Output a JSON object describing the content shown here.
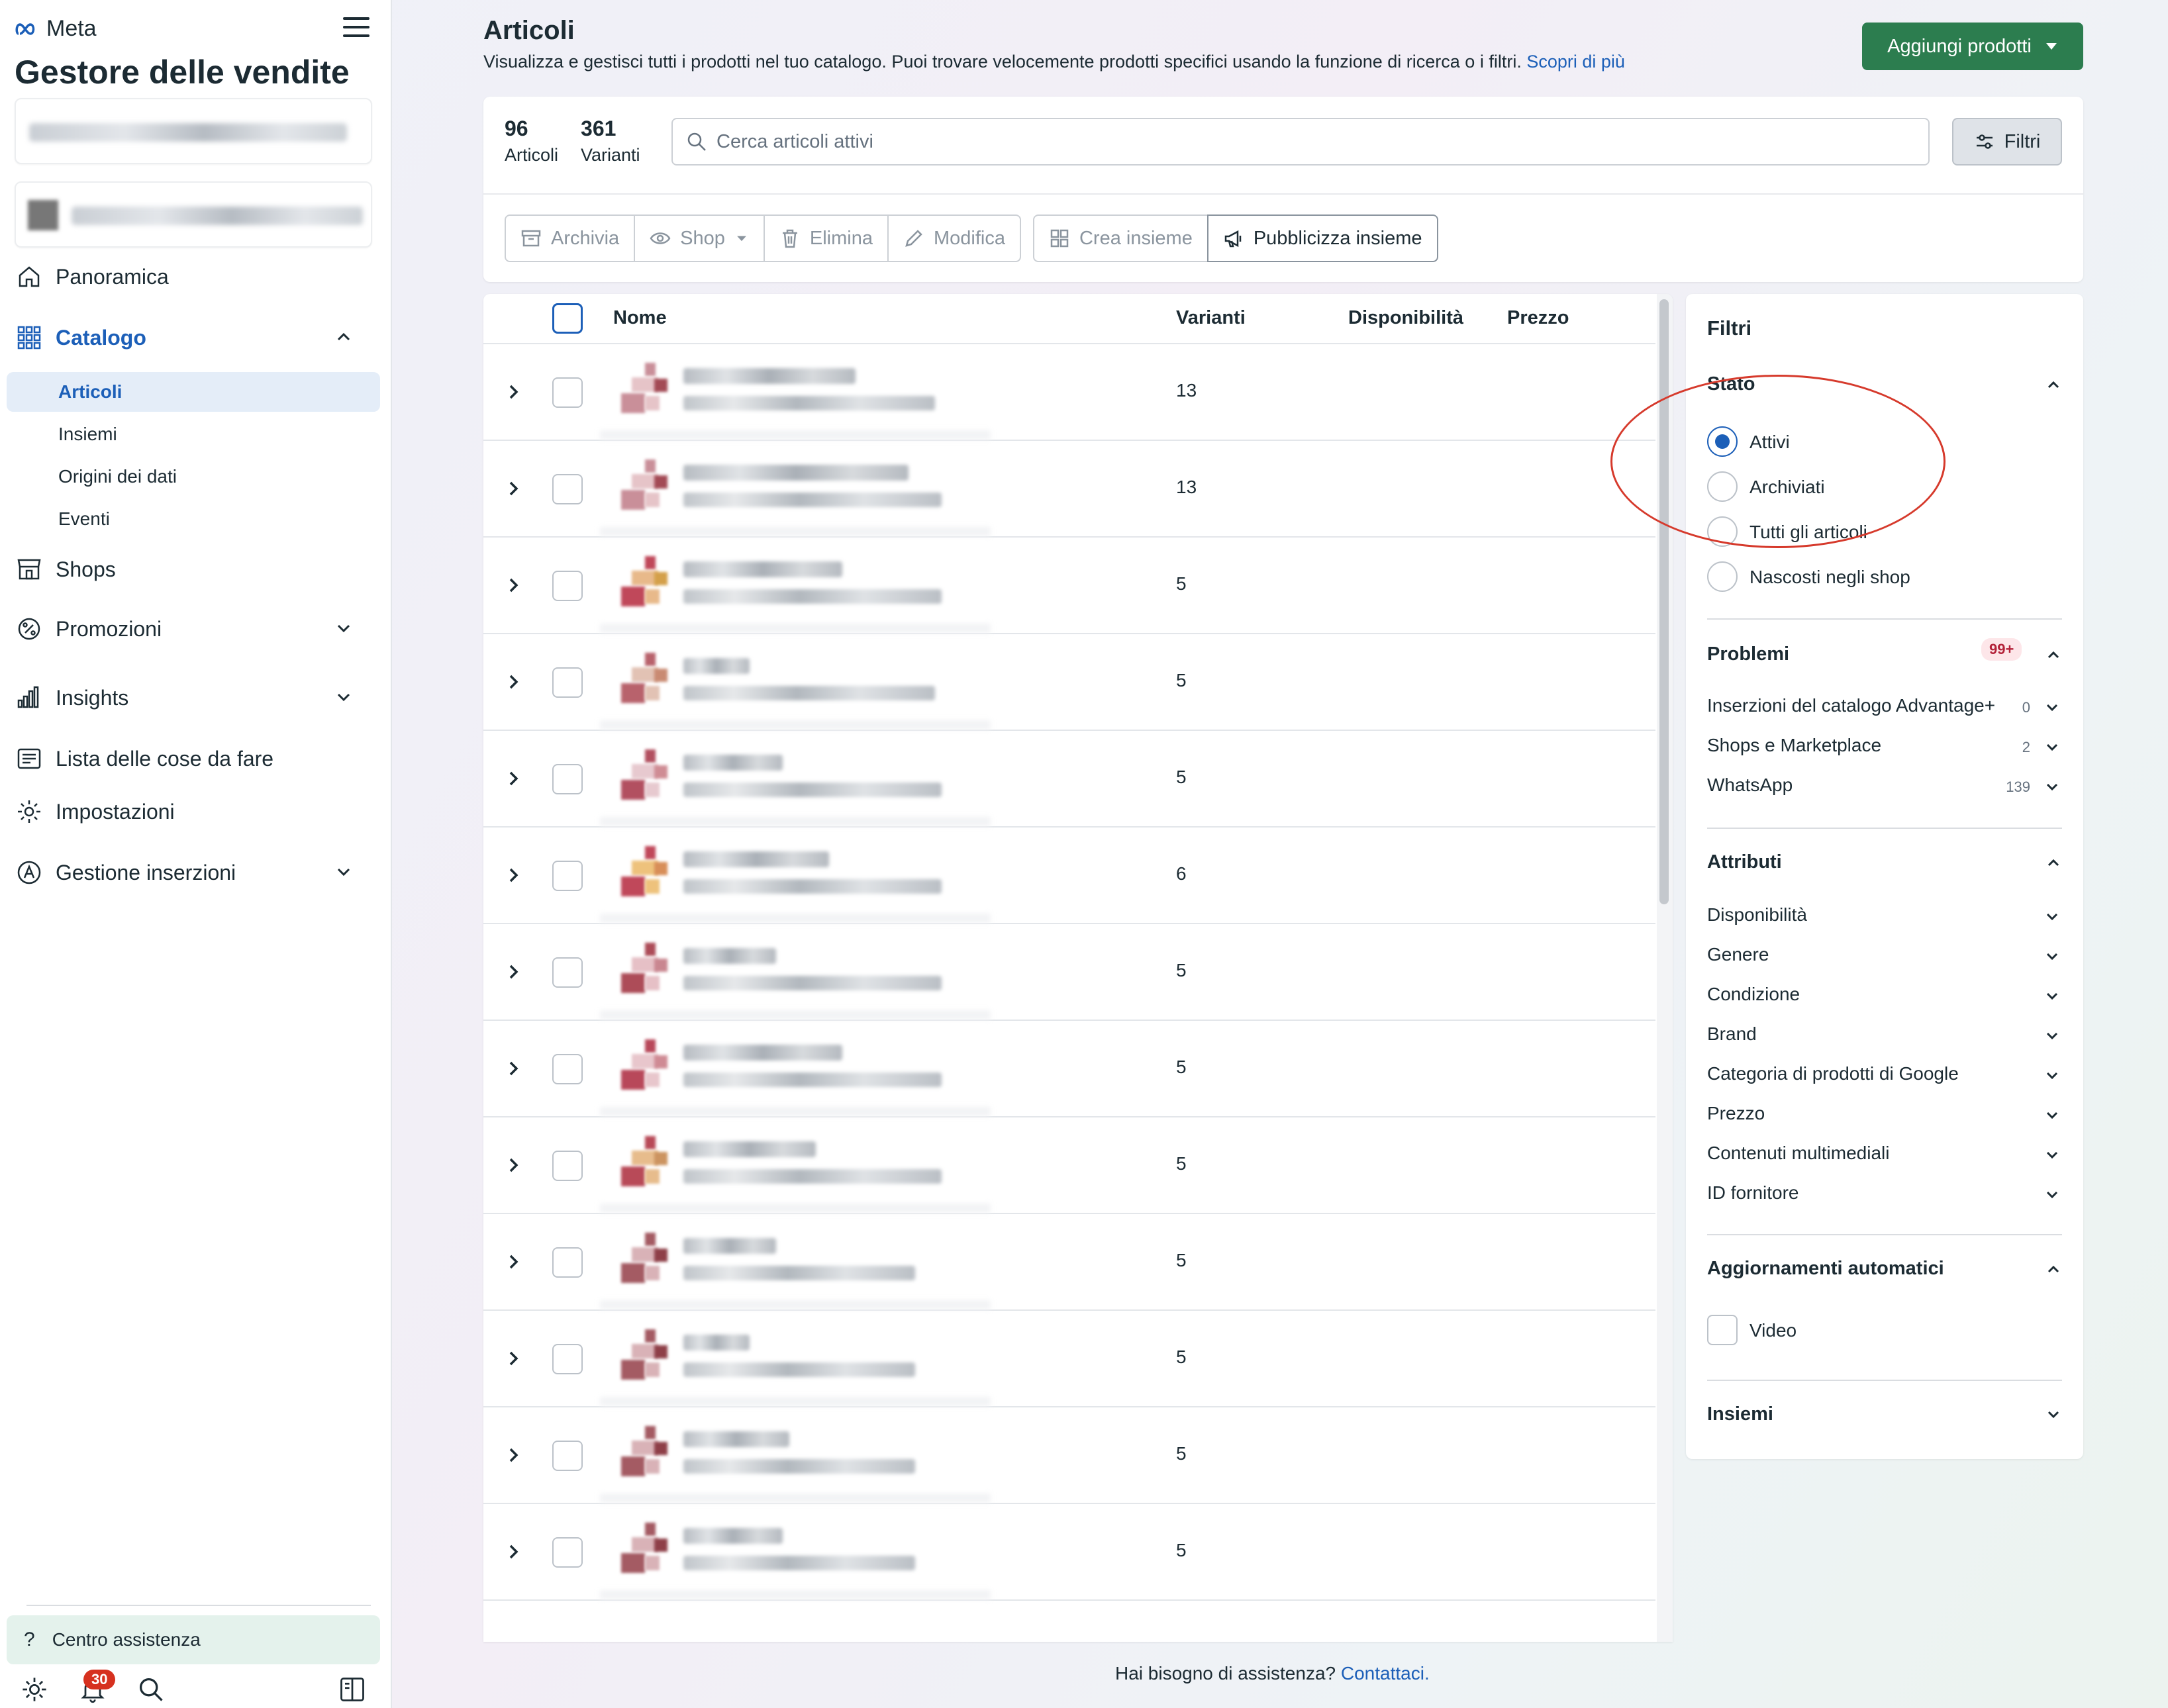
{
  "app": {
    "brand": "Meta",
    "title": "Gestore delle vendite"
  },
  "sidebar": {
    "items": [
      {
        "label": "Panoramica",
        "icon": "home-icon"
      },
      {
        "label": "Catalogo",
        "icon": "grid-icon",
        "active": true
      },
      {
        "label": "Shops",
        "icon": "store-icon"
      },
      {
        "label": "Promozioni",
        "icon": "percent-icon"
      },
      {
        "label": "Insights",
        "icon": "bar-chart-icon"
      },
      {
        "label": "Lista delle cose da fare",
        "icon": "checklist-icon"
      },
      {
        "label": "Impostazioni",
        "icon": "gear-icon"
      },
      {
        "label": "Gestione inserzioni",
        "icon": "ads-icon"
      }
    ],
    "catalog_sub": [
      "Articoli",
      "Insiemi",
      "Origini dei dati",
      "Eventi"
    ],
    "help_label": "Centro assistenza",
    "notification_count": "30"
  },
  "header": {
    "title": "Articoli",
    "description": "Visualizza e gestisci tutti i prodotti nel tuo catalogo. Puoi trovare velocemente prodotti specifici usando la funzione di ricerca o i filtri.",
    "learn_more": "Scopri di più",
    "add_button": "Aggiungi prodotti"
  },
  "summary": {
    "items_count": "96",
    "items_label": "Articoli",
    "variants_count": "361",
    "variants_label": "Varianti"
  },
  "search": {
    "placeholder": "Cerca articoli attivi"
  },
  "filters_button": "Filtri",
  "toolbar": {
    "archive": "Archivia",
    "shop": "Shop",
    "delete": "Elimina",
    "edit": "Modifica",
    "create_set": "Crea insieme",
    "advertise_set": "Pubblicizza insieme"
  },
  "table": {
    "columns": [
      "Nome",
      "Varianti",
      "Disponibilità",
      "Prezzo"
    ],
    "rows": [
      {
        "variants": "13"
      },
      {
        "variants": "13"
      },
      {
        "variants": "5"
      },
      {
        "variants": "5"
      },
      {
        "variants": "5"
      },
      {
        "variants": "6"
      },
      {
        "variants": "5"
      },
      {
        "variants": "5"
      },
      {
        "variants": "5"
      },
      {
        "variants": "5"
      },
      {
        "variants": "5"
      },
      {
        "variants": "5"
      },
      {
        "variants": "5"
      }
    ]
  },
  "filters": {
    "title": "Filtri",
    "stato": {
      "title": "Stato",
      "options": [
        "Attivi",
        "Archiviati",
        "Tutti gli articoli",
        "Nascosti negli shop"
      ],
      "selected": "Attivi"
    },
    "problemi": {
      "title": "Problemi",
      "badge": "99+",
      "items": [
        {
          "label": "Inserzioni del catalogo Advantage+",
          "count": "0"
        },
        {
          "label": "Shops e Marketplace",
          "count": "2"
        },
        {
          "label": "WhatsApp",
          "count": "139"
        }
      ]
    },
    "attributi": {
      "title": "Attributi",
      "items": [
        "Disponibilità",
        "Genere",
        "Condizione",
        "Brand",
        "Categoria di prodotti di Google",
        "Prezzo",
        "Contenuti multimediali",
        "ID fornitore"
      ]
    },
    "aggiornamenti": {
      "title": "Aggiornamenti automatici",
      "option": "Video"
    },
    "insiemi": {
      "title": "Insiemi"
    }
  },
  "footer": {
    "text": "Hai bisogno di assistenza?",
    "link": "Contattaci."
  },
  "colors": {
    "accent": "#1c5fb8",
    "primary_button": "#2c7d4f",
    "annotation": "#d63a2c"
  }
}
